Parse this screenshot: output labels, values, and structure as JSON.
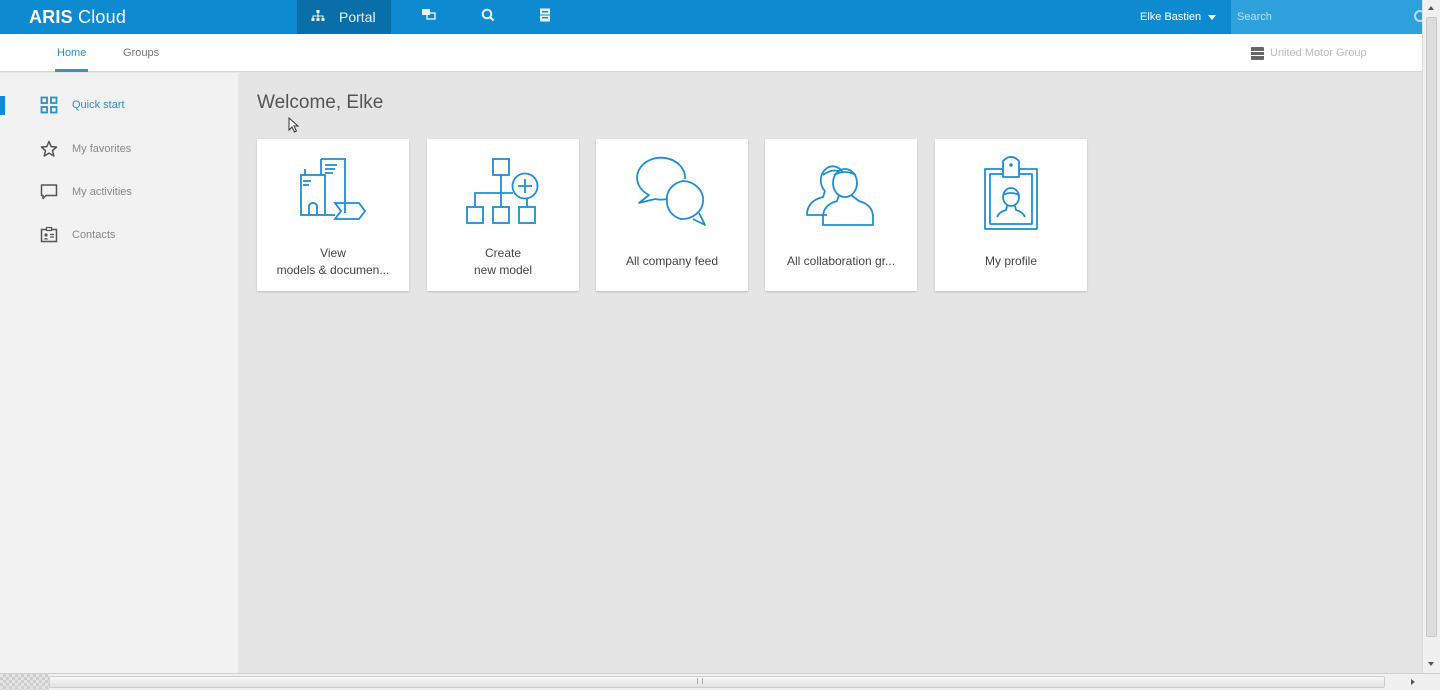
{
  "header": {
    "logo_bold": "ARIS",
    "logo_light": " Cloud",
    "nav": [
      {
        "label": "Portal",
        "icon": "sitemap-icon",
        "active": true
      },
      {
        "label": "",
        "icon": "collaboration-icon"
      },
      {
        "label": "",
        "icon": "search-icon"
      },
      {
        "label": "",
        "icon": "administration-icon"
      }
    ],
    "user_name": "Elke Bastien",
    "search_placeholder": "Search"
  },
  "subheader": {
    "tabs": [
      {
        "label": "Home",
        "active": true
      },
      {
        "label": "Groups",
        "active": false
      }
    ],
    "organization": "United Motor Group"
  },
  "sidebar": {
    "items": [
      {
        "label": "Quick start",
        "icon": "grid-icon",
        "active": true
      },
      {
        "label": "My favorites",
        "icon": "star-icon",
        "active": false
      },
      {
        "label": "My activities",
        "icon": "speech-bubble-icon",
        "active": false
      },
      {
        "label": "Contacts",
        "icon": "contact-card-icon",
        "active": false
      }
    ]
  },
  "main": {
    "welcome": "Welcome, Elke",
    "cards": [
      {
        "line1": "View",
        "line2": "models & documen...",
        "icon": "buildings-process-icon"
      },
      {
        "line1": "Create",
        "line2": "new model",
        "icon": "model-add-icon"
      },
      {
        "line1": "All company feed",
        "icon": "chat-bubbles-icon"
      },
      {
        "line1": "All collaboration gr...",
        "icon": "people-group-icon"
      },
      {
        "line1": "My profile",
        "icon": "id-badge-icon"
      }
    ]
  },
  "colors": {
    "brand": "#0e8bd0",
    "brand_dark": "#0a6fa8",
    "accent_text": "#2a8fcc",
    "icon_blue": "#1d8fd0"
  }
}
